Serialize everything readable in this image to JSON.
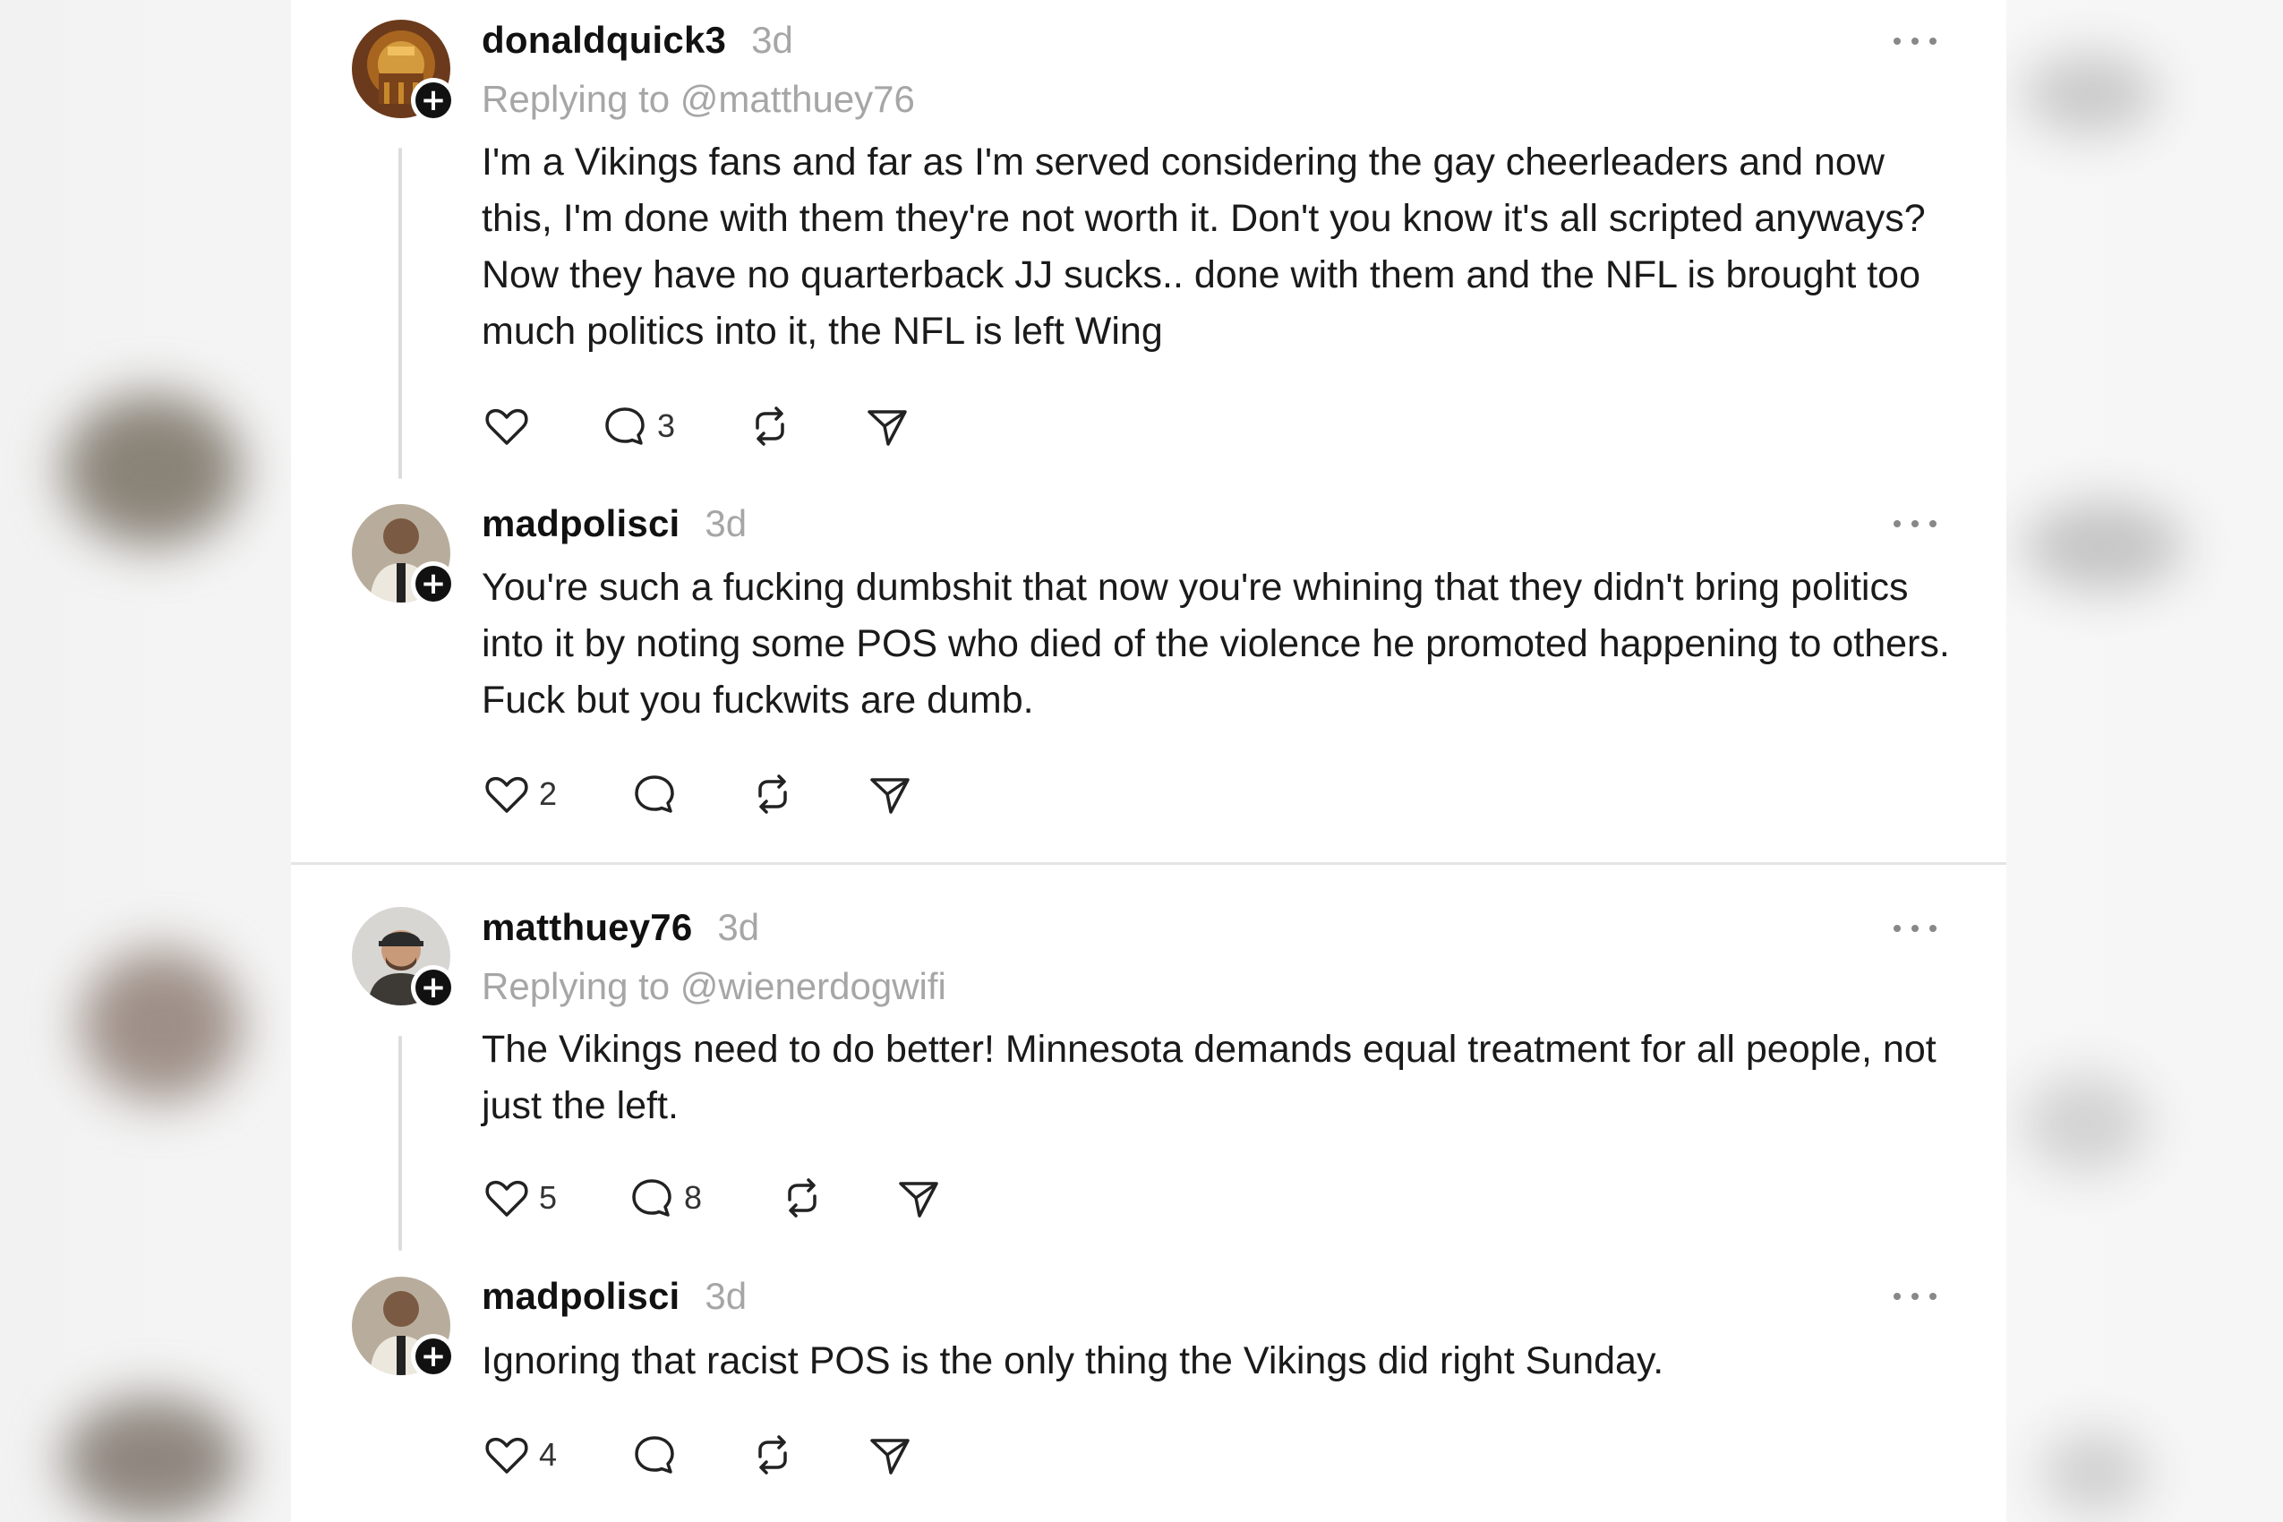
{
  "posts": [
    {
      "username": "donaldquick3",
      "time": "3d",
      "reply_to": "Replying to @matthuey76",
      "text": "I'm a Vikings fans and far as I'm served considering the gay cheerleaders and now this, I'm done with them they're not worth it. Don't you know it's all scripted anyways? Now they have no quarterback JJ sucks.. done with them and the NFL is brought too much politics into it, the NFL is left Wing",
      "likes": "",
      "replies": "3",
      "avatar_icon": "ornate-gold-avatar"
    },
    {
      "username": "madpolisci",
      "time": "3d",
      "reply_to": "",
      "text": "You're such a fucking dumbshit that now you're whining that they didn't bring politics into it by noting some POS who died of the violence he promoted happening to others. Fuck but you fuckwits are dumb.",
      "likes": "2",
      "replies": "",
      "avatar_icon": "person-avatar"
    },
    {
      "username": "matthuey76",
      "time": "3d",
      "reply_to": "Replying to @wienerdogwifi",
      "text": "The Vikings need to do better! Minnesota demands equal treatment for all people, not just the left.",
      "likes": "5",
      "replies": "8",
      "avatar_icon": "man-with-cap-avatar"
    },
    {
      "username": "madpolisci",
      "time": "3d",
      "reply_to": "",
      "text": "Ignoring that racist POS is the only thing the Vikings did right Sunday.",
      "likes": "4",
      "replies": "",
      "avatar_icon": "person-avatar"
    }
  ],
  "icons": {
    "like": "heart-icon",
    "reply": "comment-icon",
    "repost": "repost-icon",
    "share": "send-icon",
    "more": "more-icon",
    "follow": "plus-icon"
  },
  "follow_badge": "+",
  "colors": {
    "text": "#1a1a1a",
    "muted": "#a6a6a6",
    "divider": "#e4e4e4",
    "thread_line": "#dcdcdc"
  }
}
